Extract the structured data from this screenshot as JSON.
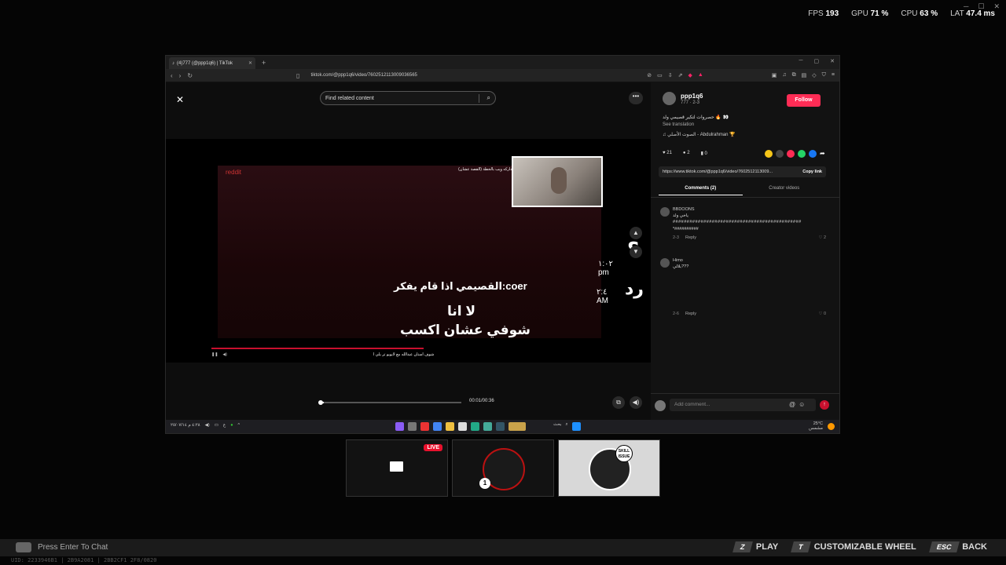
{
  "overlay": {
    "fps_label": "FPS",
    "fps": "193",
    "gpu_label": "GPU",
    "gpu": "71 %",
    "cpu_label": "CPU",
    "cpu": "63 %",
    "lat_label": "LAT",
    "lat": "47.4 ms"
  },
  "browser": {
    "tab_title": "(4)777 (@ppp1q6) | TikTok",
    "url": "tiktok.com/@ppp1q6/video/7602512113009036565"
  },
  "player": {
    "search_placeholder": "Find related content",
    "time": "00:01/00:36",
    "progress_fraction": 0.03,
    "video": {
      "reddit": "reddit",
      "caption_top": "اعلان لايويو الذي قد الي الداركه ويب بالخطة (القصة عشان)",
      "question": "؟",
      "time1": "١:٠٢ pm",
      "reply": "رد",
      "time2": "٢:٤ AM",
      "line1": "القصيمي اذا قام يفكر:coer",
      "line2": "لا انا",
      "line3": "شوفي عشان اكسب",
      "bottom_caption": "شوف استان عبدالله مع لايويو تر يلي ا"
    }
  },
  "panel": {
    "username": "ppp1q6",
    "uid": "777 · 2-3",
    "follow": "Follow",
    "description": "حصروات لتكير قصيمي ولد 🔥 👀",
    "see_translation": "See translation",
    "music": "♫ الصوت الأصلي - Abdulrahman 🏆",
    "likes": "21",
    "comments": "2",
    "saves": "0",
    "link": "https://www.tiktok.com/@ppp1q6/video/7602512113009...",
    "copy_link": "Copy link",
    "tab_comments": "Comments (2)",
    "tab_creator": "Creator videos",
    "comment_list": [
      {
        "user": "BBDOONS",
        "text": "ياخي ولد",
        "text2": "##############################################",
        "text3": "*##########",
        "meta": "2-3",
        "reply": "Reply",
        "likes": "2"
      },
      {
        "user": "Himo",
        "text": "بلالي???",
        "meta": "2-6",
        "reply": "Reply",
        "likes": "0"
      }
    ],
    "comment_placeholder": "Add comment..."
  },
  "taskbar": {
    "time": "٤:٢٨ م",
    "date": "٢٥/٠٧/١٤",
    "search": "بحث",
    "weather": "25°C",
    "weather_desc": "مشمس"
  },
  "thumbnails": {
    "live": "LIVE",
    "badge": "SKILL ISSUE",
    "number": "1"
  },
  "bottom": {
    "chat": "Press Enter To Chat",
    "play_key": "Z",
    "play": "PLAY",
    "wheel_key": "T",
    "wheel": "CUSTOMIZABLE WHEEL",
    "back_key": "ESC",
    "back": "BACK",
    "uid": "UID: 2233946B1 | 2B9A2081 | 2BB2CF1 2F8/0820"
  }
}
